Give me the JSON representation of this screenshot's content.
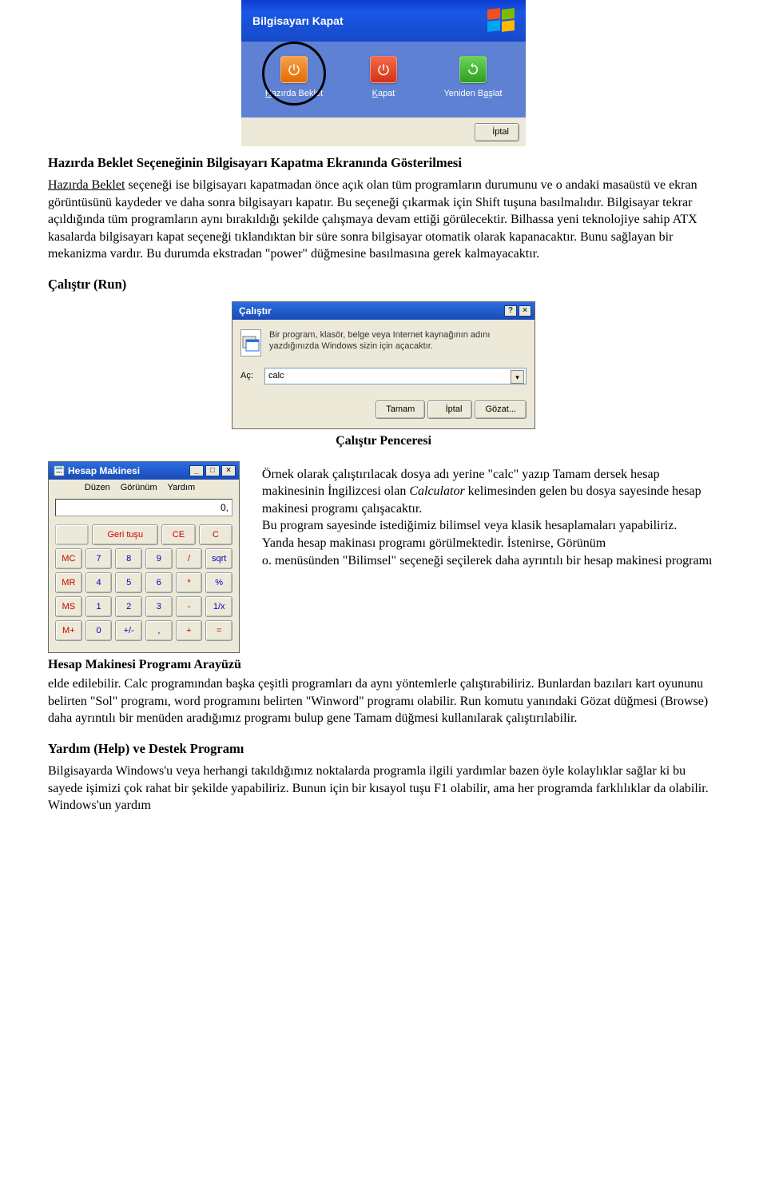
{
  "shutdown_dialog": {
    "title": "Bilgisayarı Kapat",
    "options": {
      "standby_html": "<span class=\"sd-underline\">H</span>azırda Beklet",
      "shutdown_html": "<span class=\"sd-underline\">K</span>apat",
      "restart_html": "Yeniden B<span class=\"sd-underline\">a</span>şlat"
    },
    "cancel": "İptal"
  },
  "doc": {
    "h1": "Hazırda Beklet Seçeneğinin Bilgisayarı Kapatma Ekranında Gösterilmesi",
    "p1_html": "<span class=\"underline\">Hazırda Beklet</span> seçeneği ise bilgisayarı kapatmadan önce açık olan tüm programların durumunu ve o andaki masaüstü ve ekran görüntüsünü kaydeder ve daha sonra bilgisayarı kapatır. Bu seçeneği çıkarmak için Shift tuşuna basılmalıdır. Bilgisayar tekrar açıldığında tüm programların aynı bırakıldığı şekilde çalışmaya devam ettiği görülecektir. Bilhassa yeni teknolojiye sahip ATX kasalarda bilgisayarı kapat seçeneği tıklandıktan bir süre sonra bilgisayar otomatik olarak kapanacaktır. Bunu sağlayan bir mekanizma vardır. Bu durumda ekstradan \"power\" düğmesine basılmasına gerek kalmayacaktır.",
    "h2": "Çalıştır (Run)",
    "caption_run": "Çalıştır Penceresi",
    "right_html": "Örnek olarak çalıştırılacak dosya adı yerine \"calc\" yazıp Tamam dersek hesap makinesinin İngilizcesi olan <span class=\"italic\">Calculator</span> kelimesinden gelen bu dosya sayesinde hesap makinesi programı çalışacaktır.<br>Bu program sayesinde istediğimiz bilimsel veya klasik hesaplamaları yapabiliriz.<br>Yanda hesap makinası programı görülmektedir. İstenirse, Görünüm<br>o. menüsünden \"Bilimsel\" seçeneği seçilerek daha ayrıntılı bir hesap makinesi programı",
    "calc_caption": "Hesap Makinesi Programı Arayüzü",
    "p_wrap": "elde edilebilir. Calc programından başka çeşitli programları da aynı yöntemlerle çalıştırabiliriz. Bunlardan bazıları kart oyununu belirten \"Sol\" programı, word programını belirten \"Winword\" programı olabilir. Run komutu yanındaki Gözat düğmesi (Browse) daha ayrıntılı bir menüden aradığımız programı bulup gene Tamam düğmesi kullanılarak çalıştırılabilir.",
    "h3": "Yardım (Help) ve Destek Programı",
    "p_last": "Bilgisayarda Windows'u veya herhangi takıldığımız noktalarda programla ilgili yardımlar bazen öyle kolaylıklar sağlar ki bu sayede işimizi çok rahat bir şekilde yapabiliriz. Bunun için bir kısayol tuşu F1 olabilir, ama her programda farklılıklar da olabilir. Windows'un yardım"
  },
  "run_dialog": {
    "title": "Çalıştır",
    "desc": "Bir program, klasör, belge veya Internet kaynağının adını yazdığınızda Windows sizin için açacaktır.",
    "label": "Aç:",
    "value": "calc",
    "ok": "Tamam",
    "cancel": "İptal",
    "browse": "Gözat..."
  },
  "calculator": {
    "title": "Hesap Makinesi",
    "menu": {
      "edit": "Düzen",
      "view": "Görünüm",
      "help": "Yardım"
    },
    "display": "0,",
    "rows": [
      [
        {
          "t": "",
          "c": "empty"
        },
        {
          "t": "Geri tuşu",
          "c": "red",
          "wide": true
        },
        {
          "t": "CE",
          "c": "red"
        },
        {
          "t": "C",
          "c": "red"
        }
      ],
      [
        {
          "t": "MC",
          "c": "redmem"
        },
        {
          "t": "7",
          "c": "blue"
        },
        {
          "t": "8",
          "c": "blue"
        },
        {
          "t": "9",
          "c": "blue"
        },
        {
          "t": "/",
          "c": "red"
        },
        {
          "t": "sqrt",
          "c": "blue"
        }
      ],
      [
        {
          "t": "MR",
          "c": "redmem"
        },
        {
          "t": "4",
          "c": "blue"
        },
        {
          "t": "5",
          "c": "blue"
        },
        {
          "t": "6",
          "c": "blue"
        },
        {
          "t": "*",
          "c": "red"
        },
        {
          "t": "%",
          "c": "blue"
        }
      ],
      [
        {
          "t": "MS",
          "c": "redmem"
        },
        {
          "t": "1",
          "c": "blue"
        },
        {
          "t": "2",
          "c": "blue"
        },
        {
          "t": "3",
          "c": "blue"
        },
        {
          "t": "-",
          "c": "red"
        },
        {
          "t": "1/x",
          "c": "blue"
        }
      ],
      [
        {
          "t": "M+",
          "c": "redmem"
        },
        {
          "t": "0",
          "c": "blue"
        },
        {
          "t": "+/-",
          "c": "blue"
        },
        {
          "t": ",",
          "c": "blue"
        },
        {
          "t": "+",
          "c": "red"
        },
        {
          "t": "=",
          "c": "red"
        }
      ]
    ]
  }
}
